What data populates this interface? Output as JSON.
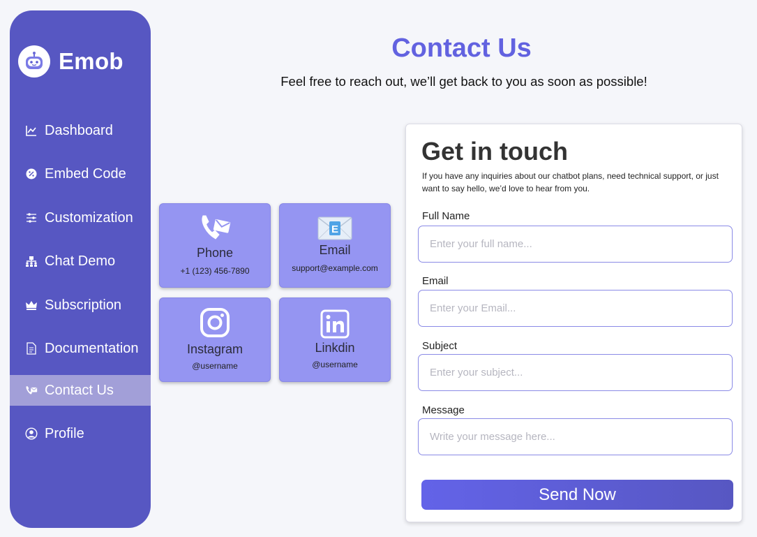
{
  "brand": {
    "name": "Emob",
    "logo_icon": "robot-icon"
  },
  "sidebar": {
    "items": [
      {
        "label": "Dashboard",
        "icon": "chart-line-icon"
      },
      {
        "label": "Embed Code",
        "icon": "percent-badge-icon"
      },
      {
        "label": "Customization",
        "icon": "sliders-icon"
      },
      {
        "label": "Chat Demo",
        "icon": "group-icon"
      },
      {
        "label": "Subscription",
        "icon": "crown-icon"
      },
      {
        "label": "Documentation",
        "icon": "document-icon"
      },
      {
        "label": "Contact Us",
        "icon": "contact-phone-icon",
        "active": true
      },
      {
        "label": "Profile",
        "icon": "user-circle-icon"
      }
    ]
  },
  "header": {
    "title": "Contact Us",
    "subtitle": "Feel free to reach out, we’ll get back to you as soon as possible!"
  },
  "cards": [
    {
      "title": "Phone",
      "value": "+1 (123) 456-7890",
      "icon": "phone-icon"
    },
    {
      "title": "Email",
      "value": "support@example.com",
      "icon": "envelope-icon"
    },
    {
      "title": "Instagram",
      "value": "@username",
      "icon": "instagram-icon"
    },
    {
      "title": "Linkdin",
      "value": "@username",
      "icon": "linkedin-icon"
    }
  ],
  "form": {
    "title": "Get in touch",
    "description": "If you have any inquiries about our chatbot plans, need technical support, or just want to say hello, we’d love to hear from you.",
    "fields": {
      "full_name": {
        "label": "Full Name",
        "placeholder": "Enter your full name..."
      },
      "email": {
        "label": "Email",
        "placeholder": "Enter your Email..."
      },
      "subject": {
        "label": "Subject",
        "placeholder": "Enter your subject..."
      },
      "message": {
        "label": "Message",
        "placeholder": "Write your message here..."
      }
    },
    "submit_label": "Send Now"
  },
  "colors": {
    "sidebar_bg": "#5757c2",
    "sidebar_active": "#a29fd8",
    "accent": "#6262e0",
    "card_bg": "#9595f2",
    "page_bg": "#f5f6fa"
  }
}
